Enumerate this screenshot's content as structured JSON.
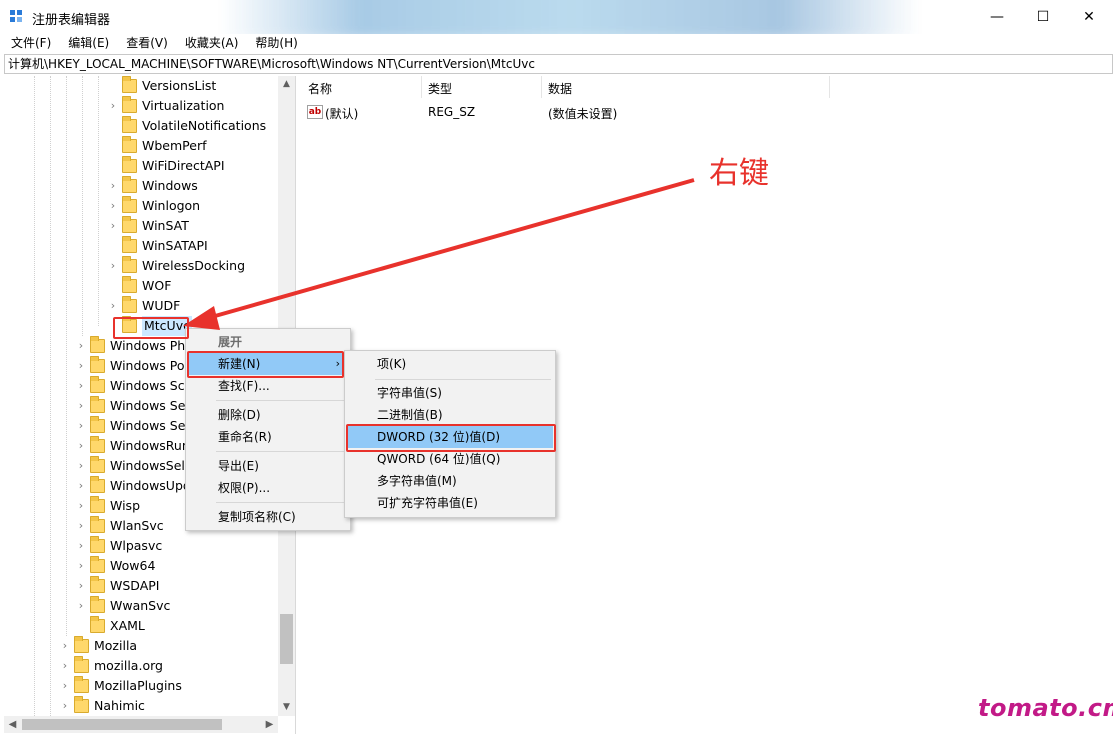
{
  "window": {
    "title": "注册表编辑器",
    "minimize": "—",
    "maximize": "☐",
    "close": "✕"
  },
  "menubar": [
    "文件(F)",
    "编辑(E)",
    "查看(V)",
    "收藏夹(A)",
    "帮助(H)"
  ],
  "address": "计算机\\HKEY_LOCAL_MACHINE\\SOFTWARE\\Microsoft\\Windows NT\\CurrentVersion\\MtcUvc",
  "tree": {
    "deep_items": [
      {
        "label": "VersionsList",
        "expandable": false
      },
      {
        "label": "Virtualization",
        "expandable": true
      },
      {
        "label": "VolatileNotifications",
        "expandable": false
      },
      {
        "label": "WbemPerf",
        "expandable": false
      },
      {
        "label": "WiFiDirectAPI",
        "expandable": false
      },
      {
        "label": "Windows",
        "expandable": true
      },
      {
        "label": "Winlogon",
        "expandable": true
      },
      {
        "label": "WinSAT",
        "expandable": true
      },
      {
        "label": "WinSATAPI",
        "expandable": false
      },
      {
        "label": "WirelessDocking",
        "expandable": true
      },
      {
        "label": "WOF",
        "expandable": false
      },
      {
        "label": "WUDF",
        "expandable": true
      },
      {
        "label": "MtcUvc",
        "expandable": false,
        "selected": true
      }
    ],
    "mid_items": [
      {
        "label": "Windows Pho",
        "expandable": true
      },
      {
        "label": "Windows Por",
        "expandable": true
      },
      {
        "label": "Windows Scr",
        "expandable": true
      },
      {
        "label": "Windows Sea",
        "expandable": true
      },
      {
        "label": "Windows Sec",
        "expandable": true
      },
      {
        "label": "WindowsRun",
        "expandable": true
      },
      {
        "label": "WindowsSelf",
        "expandable": true
      },
      {
        "label": "WindowsUpd",
        "expandable": true
      },
      {
        "label": "Wisp",
        "expandable": true
      },
      {
        "label": "WlanSvc",
        "expandable": true
      },
      {
        "label": "Wlpasvc",
        "expandable": true
      },
      {
        "label": "Wow64",
        "expandable": true
      },
      {
        "label": "WSDAPI",
        "expandable": true
      },
      {
        "label": "WwanSvc",
        "expandable": true
      },
      {
        "label": "XAML",
        "expandable": false
      }
    ],
    "top_items": [
      {
        "label": "Mozilla",
        "expandable": true
      },
      {
        "label": "mozilla.org",
        "expandable": true
      },
      {
        "label": "MozillaPlugins",
        "expandable": true
      },
      {
        "label": "Nahimic",
        "expandable": true
      }
    ]
  },
  "values_pane": {
    "columns": [
      "名称",
      "类型",
      "数据"
    ],
    "rows": [
      {
        "icon": "ab",
        "name": "(默认)",
        "type": "REG_SZ",
        "data": "(数值未设置)"
      }
    ]
  },
  "context_menu": {
    "items": [
      "展开",
      "新建(N)",
      "查找(F)...",
      "删除(D)",
      "重命名(R)",
      "导出(E)",
      "权限(P)...",
      "复制项名称(C)"
    ]
  },
  "submenu": {
    "items": [
      "项(K)",
      "字符串值(S)",
      "二进制值(B)",
      "DWORD (32 位)值(D)",
      "QWORD (64 位)值(Q)",
      "多字符串值(M)",
      "可扩充字符串值(E)"
    ]
  },
  "annotation": {
    "label": "右键",
    "color": "#e8322c"
  },
  "watermark": "tomato.cm",
  "colors": {
    "highlight": "#91c9f7",
    "selection": "#cce8ff",
    "annotation_red": "#e8322c",
    "watermark": "#c21a87"
  }
}
